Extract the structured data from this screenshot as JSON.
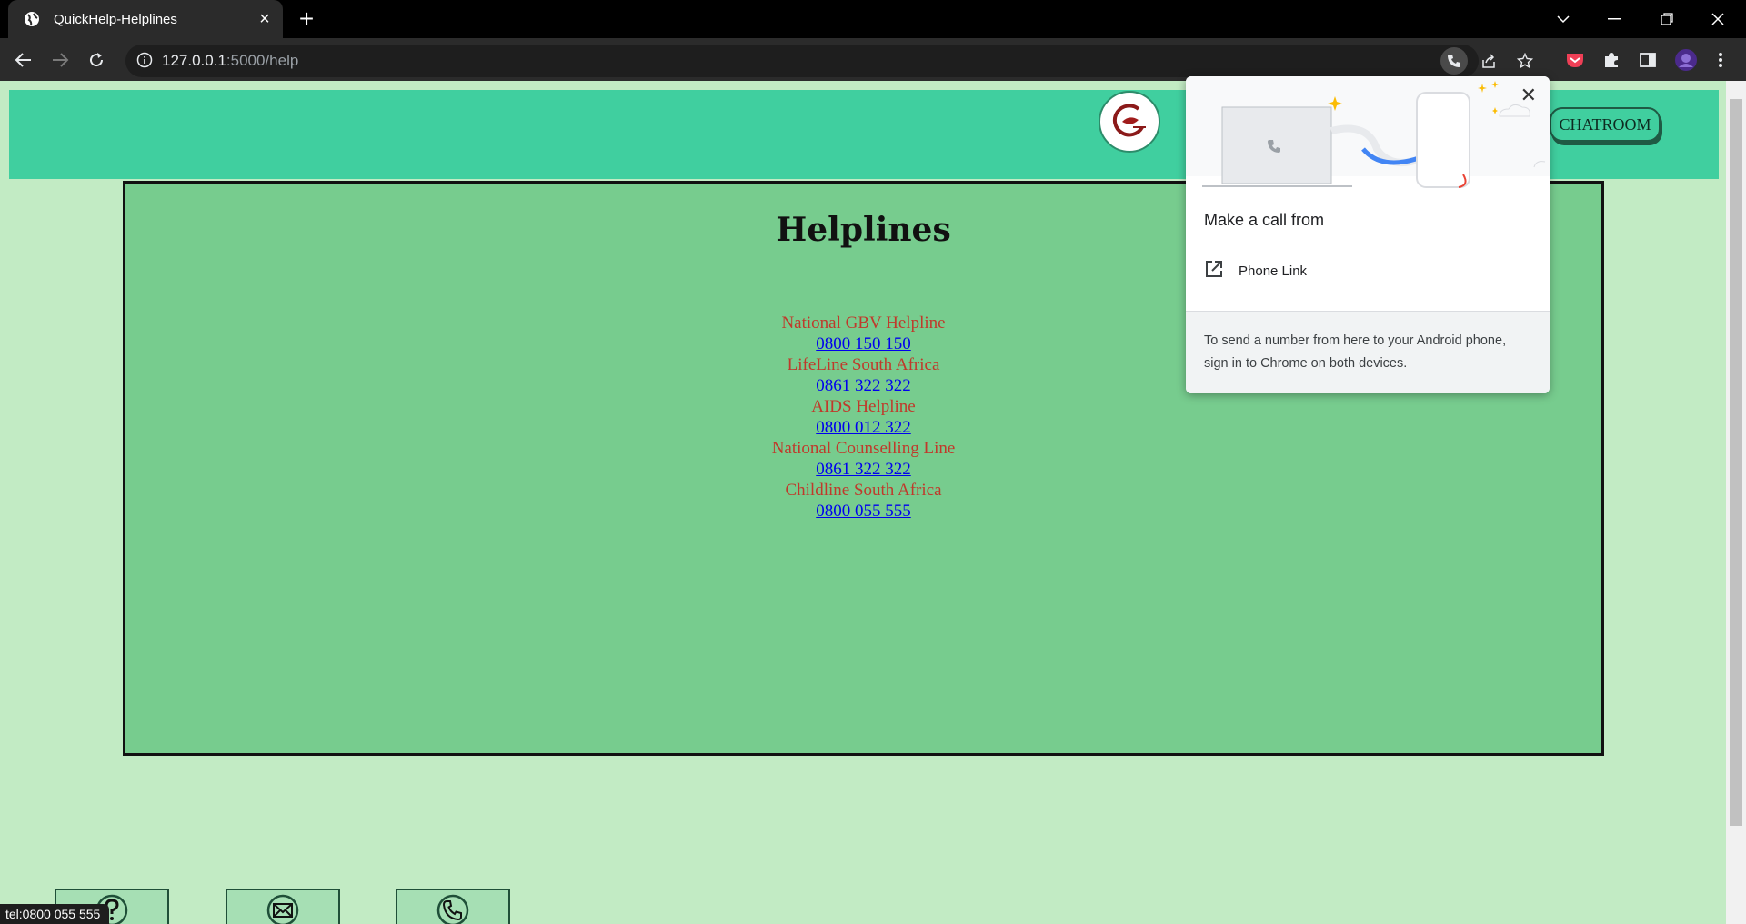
{
  "browser": {
    "tab_title": "QuickHelp-Helplines",
    "url_host": "127.0.0.1",
    "url_path": ":5000/help"
  },
  "header": {
    "chatroom_label": "CHATROOM"
  },
  "main": {
    "heading": "Helplines",
    "helplines": [
      {
        "name": "National GBV Helpline",
        "number": "0800 150 150"
      },
      {
        "name": "LifeLine South Africa",
        "number": "0861 322 322"
      },
      {
        "name": "AIDS Helpline",
        "number": "0800 012 322"
      },
      {
        "name": "National Counselling Line",
        "number": "0861 322 322"
      },
      {
        "name": "Childline South Africa",
        "number": "0800 055 555"
      }
    ]
  },
  "popup": {
    "title": "Make a call from",
    "item_label": "Phone Link",
    "footer_text": "To send a number from here to your Android phone, sign in to Chrome on both devices."
  },
  "status_bar": {
    "text": "tel:0800 055 555"
  },
  "colors": {
    "header_bg": "#40cf9f",
    "main_bg": "#77cc8e",
    "page_bg": "#c2ebc4",
    "helpline_name": "#c0392b",
    "link": "#0000ee"
  },
  "icons": [
    "globe-icon",
    "close-icon",
    "plus-icon",
    "back-icon",
    "forward-icon",
    "reload-icon",
    "info-icon",
    "phone-icon",
    "share-icon",
    "star-icon",
    "pocket-icon",
    "puzzle-icon",
    "sidepanel-icon",
    "avatar",
    "menu-icon",
    "external-link-icon",
    "help-icon",
    "mail-icon"
  ]
}
